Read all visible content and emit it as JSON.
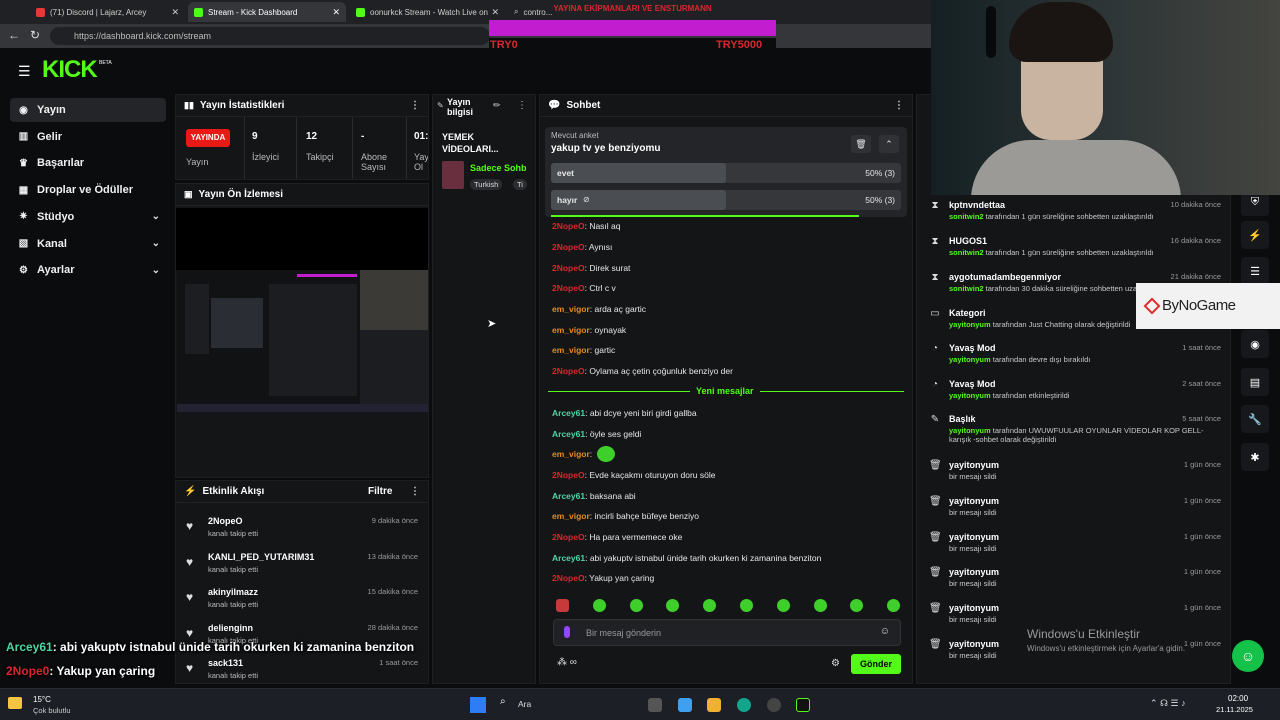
{
  "browser": {
    "tabs": [
      "(71) Discord | Lajarz, Arcey",
      "Stream - Kick Dashboard",
      "oonurkck Stream - Watch Live on",
      "contro..."
    ],
    "url": "https://dashboard.kick.com/stream"
  },
  "overlay": {
    "banner_title": "YAYINA EKİPMANLARI VE ENSTURMANN",
    "bar_left": "TRY0",
    "bar_right": "TRY5000",
    "watermark": "ByNoGame",
    "chat_overlay": [
      {
        "user": "Arcey61",
        "text": ": abi yakuptv istnabul ünide tarih okurken ki zamanina benziton"
      },
      {
        "user": "2Nope0",
        "text": ": Yakup yan çaring"
      }
    ],
    "activate_title": "Windows'u Etkinleştir",
    "activate_sub": "Windows'u etkinleştirmek için Ayarlar'a gidin."
  },
  "brand": {
    "logo": "KICK",
    "beta": "BETA"
  },
  "sidebar": {
    "items": [
      {
        "label": "Yayın",
        "icon": "broadcast-icon"
      },
      {
        "label": "Gelir",
        "icon": "revenue-icon"
      },
      {
        "label": "Başarılar",
        "icon": "trophy-icon"
      },
      {
        "label": "Droplar ve Ödüller",
        "icon": "gift-icon"
      },
      {
        "label": "Stüdyo",
        "icon": "studio-icon"
      },
      {
        "label": "Kanal",
        "icon": "channel-icon"
      },
      {
        "label": "Ayarlar",
        "icon": "settings-icon"
      }
    ]
  },
  "stats": {
    "title": "Yayın İstatistikleri",
    "live_badge": "YAYINDA",
    "live_label": "Yayın",
    "viewers": "9",
    "viewers_label": "İzleyici",
    "followers": "12",
    "followers_label": "Takipçi",
    "subs": "-",
    "subs_label": "Abone Sayısı",
    "uptime": "01:",
    "uptime_label": "Yay Ol"
  },
  "preview": {
    "title": "Yayın Ön İzlemesi"
  },
  "info": {
    "title": "Yayın bilgisi",
    "stream_title": "YEMEK VİDEOLARI...",
    "category": "Sadece Sohb",
    "tags": [
      "Turkish",
      "Ti"
    ]
  },
  "feed": {
    "title": "Etkinlik Akışı",
    "filter": "Filtre",
    "items": [
      {
        "name": "2NopeO",
        "sub": "kanalı takip etti",
        "time": "9 dakika önce"
      },
      {
        "name": "KANLI_PED_YUTARIM31",
        "sub": "kanalı takip etti",
        "time": "13 dakika önce"
      },
      {
        "name": "akinyilmazz",
        "sub": "kanalı takip etti",
        "time": "15 dakika önce"
      },
      {
        "name": "delienginn",
        "sub": "kanalı takip etti",
        "time": "28 dakika önce"
      },
      {
        "name": "sack131",
        "sub": "kanalı takip etti",
        "time": "1 saat önce"
      }
    ]
  },
  "chat": {
    "title": "Sohbet",
    "poll": {
      "label": "Mevcut anket",
      "question": "yakup tv ye benziyomu",
      "options": [
        {
          "text": "evet",
          "result": "50% (3)",
          "share": 0.5
        },
        {
          "text": "hayır",
          "result": "50% (3)",
          "share": 0.5
        }
      ],
      "remaining": 0.88
    },
    "messages": [
      {
        "user": "2NopeO",
        "text": ": Nasıl aq",
        "color": "red"
      },
      {
        "user": "2NopeO",
        "text": ": Aynısı",
        "color": "red"
      },
      {
        "user": "2NopeO",
        "text": ": Direk surat",
        "color": "red"
      },
      {
        "user": "2NopeO",
        "text": ": Ctrl c v",
        "color": "red"
      },
      {
        "user": "em_vigor",
        "text": ": arda aç gartic",
        "color": "orange"
      },
      {
        "user": "em_vigor",
        "text": ": oynayak",
        "color": "orange"
      },
      {
        "user": "em_vigor",
        "text": ": gartic",
        "color": "orange"
      },
      {
        "user": "2NopeO",
        "text": ": Oylama aç çetin çoğunluk benziyo der",
        "color": "red"
      }
    ],
    "new_label": "Yeni mesajlar",
    "messages2": [
      {
        "user": "Arcey61",
        "text": ": abi dcye yeni biri girdi gallba",
        "color": "teal"
      },
      {
        "user": "Arcey61",
        "text": ": öyle ses geldi",
        "color": "teal"
      },
      {
        "user": "em_vigor",
        "text": ":",
        "color": "orange"
      },
      {
        "user": "2NopeO",
        "text": ": Evde kaçakmı oturuyon doru söle",
        "color": "red"
      },
      {
        "user": "Arcey61",
        "text": ": baksana abi",
        "color": "teal"
      },
      {
        "user": "em_vigor",
        "text": ": incirli bahçe büfeye benziyo",
        "color": "orange"
      },
      {
        "user": "2NopeO",
        "text": ": Ha para vermemece oke",
        "color": "red"
      },
      {
        "user": "Arcey61",
        "text": ": abi yakuptv istnabul ünide tarih okurken ki zamanina benziton",
        "color": "teal"
      },
      {
        "user": "2NopeO",
        "text": ": Yakup yan çaring",
        "color": "red"
      }
    ],
    "input_placeholder": "Bir mesaj gönderin",
    "send": "Gönder"
  },
  "mod": {
    "items": [
      {
        "title": "kptnvndettaa",
        "who": "sonitwin2",
        "rest": " tarafından 1 gün süreliğine sohbetten uzaklaştırıldı",
        "time": "10 dakika önce",
        "icon": "timeout-icon"
      },
      {
        "title": "HUGOS1",
        "who": "sonitwin2",
        "rest": " tarafından 1 gün süreliğine sohbetten uzaklaştırıldı",
        "time": "16 dakika önce",
        "icon": "timeout-icon"
      },
      {
        "title": "aygotumadambegenmiyor",
        "who": "sonitwin2",
        "rest": " tarafından 30 dakika süreliğine sohbetten uzaklaştırıldı",
        "time": "21 dakika önce",
        "icon": "timeout-icon"
      },
      {
        "title": "Kategori",
        "who": "yayitonyum",
        "rest": " tarafından Just Chatting olarak değiştirildi",
        "time": "",
        "icon": "category-icon"
      },
      {
        "title": "Yavaş Mod",
        "who": "yayitonyum",
        "rest": " tarafından devre dışı bırakıldı",
        "time": "1 saat önce",
        "icon": "slow-mode-icon"
      },
      {
        "title": "Yavaş Mod",
        "who": "yayitonyum",
        "rest": " tarafından etkinleştirildi",
        "time": "2 saat önce",
        "icon": "slow-mode-icon"
      },
      {
        "title": "Başlık",
        "who": "yayitonyum",
        "rest": " tarafından UWUWFUULAR OYUNLAR VİDEOLAR KOP GELL-karışık -sohbet olarak değiştirildi",
        "time": "5 saat önce",
        "icon": "title-icon"
      },
      {
        "title": "yayitonyum",
        "who": "",
        "rest": "bir mesajı sildi",
        "time": "1 gün önce",
        "icon": "trash-icon"
      },
      {
        "title": "yayitonyum",
        "who": "",
        "rest": "bir mesajı sildi",
        "time": "1 gün önce",
        "icon": "trash-icon"
      },
      {
        "title": "yayitonyum",
        "who": "",
        "rest": "bir mesajı sildi",
        "time": "1 gün önce",
        "icon": "trash-icon"
      },
      {
        "title": "yayitonyum",
        "who": "",
        "rest": "bir mesajı sildi",
        "time": "1 gün önce",
        "icon": "trash-icon"
      },
      {
        "title": "yayitonyum",
        "who": "",
        "rest": "bir mesajı sildi",
        "time": "1 gün önce",
        "icon": "trash-icon"
      },
      {
        "title": "yayitonyum",
        "who": "",
        "rest": "bir mesajı sildi",
        "time": "1 gün önce",
        "icon": "trash-icon"
      }
    ]
  },
  "taskbar": {
    "weather": "15°C",
    "weather_sub": "Çok bulutlu",
    "search": "Ara",
    "time": "02:00",
    "date": "21.11.2025"
  },
  "colors": {
    "kick_green": "#53fc18",
    "live_red": "#e91916"
  }
}
